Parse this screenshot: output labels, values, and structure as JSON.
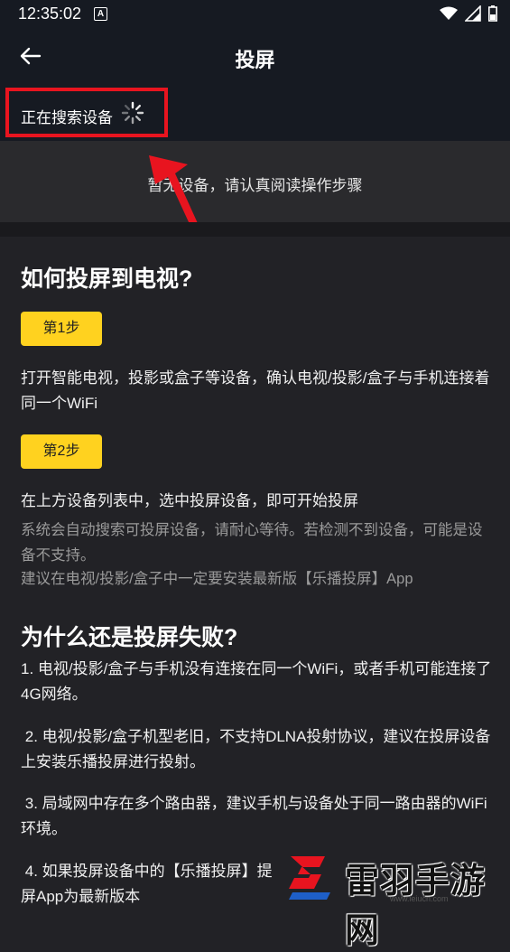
{
  "status": {
    "time": "12:35:02",
    "notif_letter": "A"
  },
  "appbar": {
    "title": "投屏"
  },
  "search": {
    "status_text": "正在搜索设备"
  },
  "empty": {
    "message": "暂无设备，请认真阅读操作步骤"
  },
  "guide": {
    "heading": "如何投屏到电视?",
    "step1_label": "第1步",
    "step1_text": "打开智能电视，投影或盒子等设备，确认电视/投影/盒子与手机连接着同一个WiFi",
    "step2_label": "第2步",
    "step2_text": "在上方设备列表中，选中投屏设备，即可开始投屏",
    "note1": "系统会自动搜索可投屏设备，请耐心等待。若检测不到设备，可能是设备不支持。",
    "note2": "建议在电视/投影/盒子中一定要安装最新版【乐播投屏】App"
  },
  "faq": {
    "heading": "为什么还是投屏失败?",
    "item1": "1. 电视/投影/盒子与手机没有连接在同一个WiFi，或者手机可能连接了4G网络。",
    "item2": " 2. 电视/投影/盒子机型老旧，不支持DLNA投射协议，建议在投屏设备上安装乐播投屏进行投射。",
    "item3": " 3. 局域网中存在多个路由器，建议手机与设备处于同一路由器的WiFi环境。",
    "item4": " 4. 如果投屏设备中的【乐播投屏】提",
    "item4b": "屏App为最新版本"
  },
  "watermark": {
    "text": "雷羽手游网",
    "url": "www.leiucn.com"
  },
  "colors": {
    "step_bg": "#ffd21f",
    "highlight": "#e8141f",
    "bar_bg": "#161a22"
  }
}
